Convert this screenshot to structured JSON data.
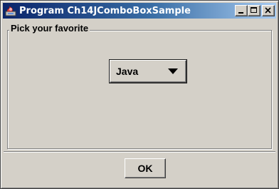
{
  "window": {
    "title": "Program Ch14JComboBoxSample",
    "icon": "java-app-icon",
    "controls": [
      "minimize-icon",
      "maximize-icon",
      "close-icon"
    ]
  },
  "group": {
    "legend": "Pick your favorite"
  },
  "combo": {
    "selected": "Java",
    "arrow_icon": "triangle-down-icon"
  },
  "buttons": {
    "ok_label": "OK"
  },
  "colors": {
    "titlebar_start": "#0a246a",
    "titlebar_end": "#a6caf0",
    "face": "#d4d0c8"
  }
}
